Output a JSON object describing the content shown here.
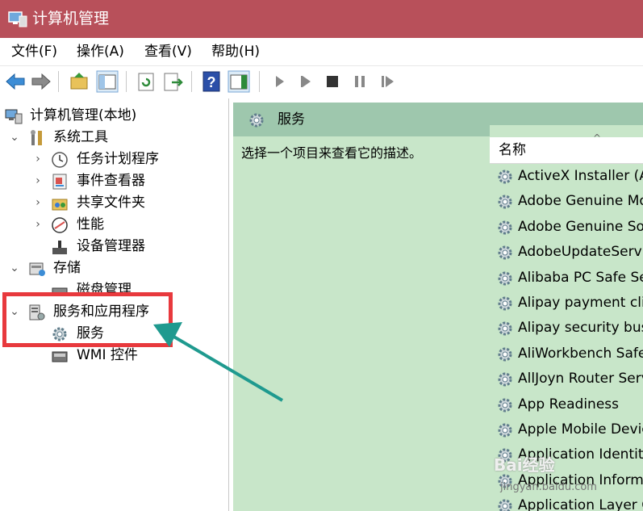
{
  "window": {
    "title": "计算机管理"
  },
  "menu": [
    "文件(F)",
    "操作(A)",
    "查看(V)",
    "帮助(H)"
  ],
  "toolbar": {
    "buttons": [
      "back-arrow-icon",
      "forward-arrow-icon",
      "up-folder-icon",
      "show-hide-tree-icon",
      "refresh-icon",
      "export-list-icon",
      "help-icon",
      "action-pane-icon",
      "play-icon",
      "play-next-icon",
      "stop-icon",
      "pause-icon",
      "restart-icon"
    ]
  },
  "tree": {
    "root": "计算机管理(本地)",
    "system_tools": "系统工具",
    "task_scheduler": "任务计划程序",
    "event_viewer": "事件查看器",
    "shared_folders": "共享文件夹",
    "performance": "性能",
    "device_manager": "设备管理器",
    "storage": "存储",
    "disk_management": "磁盘管理",
    "services_apps": "服务和应用程序",
    "services": "服务",
    "wmi": "WMI 控件"
  },
  "right_pane": {
    "title": "服务",
    "description": "选择一个项目来查看它的描述。",
    "column_name": "名称",
    "sort_indicator": "^",
    "services": [
      "ActiveX Installer (Ax",
      "Adobe Genuine Mo",
      "Adobe Genuine So",
      "AdobeUpdateServi",
      "Alibaba PC Safe Se",
      "Alipay payment clie",
      "Alipay security busi",
      "AliWorkbench Safe",
      "AllJoyn Router Serv",
      "App Readiness",
      "Apple Mobile Devic",
      "Application Identity",
      "Application Informa",
      "Application Layer G"
    ]
  },
  "watermark": {
    "main": "Bai经验",
    "sub": "jingyan.baidu.com"
  },
  "colors": {
    "titlebar": "#b8505a",
    "right_pane_bg": "#c8e6c9",
    "right_header_bg": "#9ec7ad",
    "annotation_red": "#e8393d",
    "annotation_arrow": "#1f9a8f"
  }
}
